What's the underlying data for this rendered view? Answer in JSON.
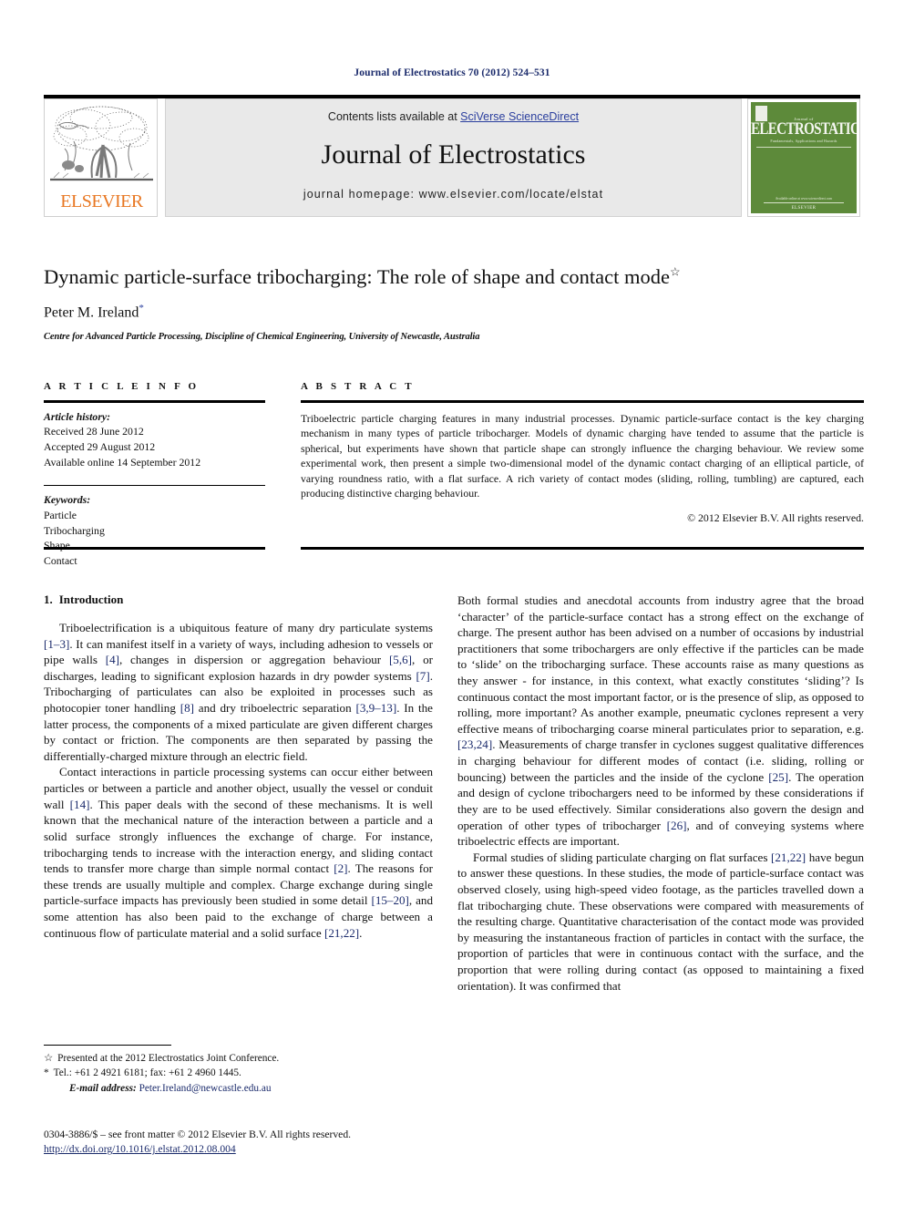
{
  "running_head": "Journal of Electrostatics 70 (2012) 524–531",
  "masthead": {
    "publisher_logo_word": "ELSEVIER",
    "contents_prefix": "Contents lists available at ",
    "contents_link": "SciVerse ScienceDirect",
    "journal_name": "Journal of Electrostatics",
    "homepage": "journal homepage: www.elsevier.com/locate/elstat",
    "cover": {
      "superline": "Journal of",
      "title": "ELECTROSTATICS",
      "subtitle": "Fundamentals, Applications and Hazards",
      "footline": "Available online at www.sciencedirect.com",
      "imprint": "ELSEVIER"
    }
  },
  "title": {
    "text": "Dynamic particle-surface tribocharging: The role of shape and contact mode",
    "star": "☆"
  },
  "author": {
    "name": "Peter M. Ireland",
    "corresponding_mark": "*",
    "affiliation": "Centre for Advanced Particle Processing, Discipline of Chemical Engineering, University of Newcastle, Australia"
  },
  "article_info": {
    "heading": "A R T I C L E   I N F O",
    "history_label": "Article history:",
    "history": [
      "Received 28 June 2012",
      "Accepted 29 August 2012",
      "Available online 14 September 2012"
    ],
    "keywords_label": "Keywords:",
    "keywords": [
      "Particle",
      "Tribocharging",
      "Shape",
      "Contact"
    ]
  },
  "abstract": {
    "heading": "A B S T R A C T",
    "text": "Triboelectric particle charging features in many industrial processes. Dynamic particle-surface contact is the key charging mechanism in many types of particle tribocharger. Models of dynamic charging have tended to assume that the particle is spherical, but experiments have shown that particle shape can strongly influence the charging behaviour. We review some experimental work, then present a simple two-dimensional model of the dynamic contact charging of an elliptical particle, of varying roundness ratio, with a flat surface. A rich variety of contact modes (sliding, rolling, tumbling) are captured, each producing distinctive charging behaviour.",
    "copyright": "© 2012 Elsevier B.V. All rights reserved."
  },
  "body": {
    "section_number": "1.",
    "section_title": "Introduction",
    "left_paragraphs": [
      "Triboelectrification is a ubiquitous feature of many dry particulate systems [1–3]. It can manifest itself in a variety of ways, including adhesion to vessels or pipe walls [4], changes in dispersion or aggregation behaviour [5,6], or discharges, leading to significant explosion hazards in dry powder systems [7]. Tribocharging of particulates can also be exploited in processes such as photocopier toner handling [8] and dry triboelectric separation [3,9–13]. In the latter process, the components of a mixed particulate are given different charges by contact or friction. The components are then separated by passing the differentially-charged mixture through an electric field.",
      "Contact interactions in particle processing systems can occur either between particles or between a particle and another object, usually the vessel or conduit wall [14]. This paper deals with the second of these mechanisms. It is well known that the mechanical nature of the interaction between a particle and a solid surface strongly influences the exchange of charge. For instance, tribocharging tends to increase with the interaction energy, and sliding contact tends to transfer more charge than simple normal contact [2]. The reasons for these trends are usually multiple and complex. Charge exchange during single particle-surface impacts has previously been studied in some detail [15–20], and some attention has also been paid to the exchange of charge between a continuous flow of particulate material and a solid surface [21,22]."
    ],
    "right_paragraphs": [
      "Both formal studies and anecdotal accounts from industry agree that the broad ‘character’ of the particle-surface contact has a strong effect on the exchange of charge. The present author has been advised on a number of occasions by industrial practitioners that some tribochargers are only effective if the particles can be made to ‘slide’ on the tribocharging surface. These accounts raise as many questions as they answer - for instance, in this context, what exactly constitutes ‘sliding’? Is continuous contact the most important factor, or is the presence of slip, as opposed to rolling, more important? As another example, pneumatic cyclones represent a very effective means of tribocharging coarse mineral particulates prior to separation, e.g. [23,24]. Measurements of charge transfer in cyclones suggest qualitative differences in charging behaviour for different modes of contact (i.e. sliding, rolling or bouncing) between the particles and the inside of the cyclone [25]. The operation and design of cyclone tribochargers need to be informed by these considerations if they are to be used effectively. Similar considerations also govern the design and operation of other types of tribocharger [26], and of conveying systems where triboelectric effects are important.",
      "Formal studies of sliding particulate charging on flat surfaces [21,22] have begun to answer these questions. In these studies, the mode of particle-surface contact was observed closely, using high-speed video footage, as the particles travelled down a flat tribocharging chute. These observations were compared with measurements of the resulting charge. Quantitative characterisation of the contact mode was provided by measuring the instantaneous fraction of particles in contact with the surface, the proportion of particles that were in continuous contact with the surface, and the proportion that were rolling during contact (as opposed to maintaining a fixed orientation). It was confirmed that"
    ]
  },
  "footnotes": {
    "conference": {
      "mark": "☆",
      "text": "Presented at the 2012 Electrostatics Joint Conference."
    },
    "contact": {
      "mark": "*",
      "text": "Tel.: +61 2 4921 6181; fax: +61 2 4960 1445."
    },
    "email": {
      "label": "E-mail address:",
      "value": "Peter.Ireland@newcastle.edu.au"
    }
  },
  "imprint": {
    "line": "0304-3886/$ – see front matter © 2012 Elsevier B.V. All rights reserved.",
    "doi": "http://dx.doi.org/10.1016/j.elstat.2012.08.004"
  },
  "colors": {
    "cite_blue": "#1a2a6b",
    "link_blue": "#2b3f9e",
    "elsevier_orange": "#E87722",
    "cover_green": "#5d8a3a",
    "masthead_gray": "#e9e9e9"
  }
}
